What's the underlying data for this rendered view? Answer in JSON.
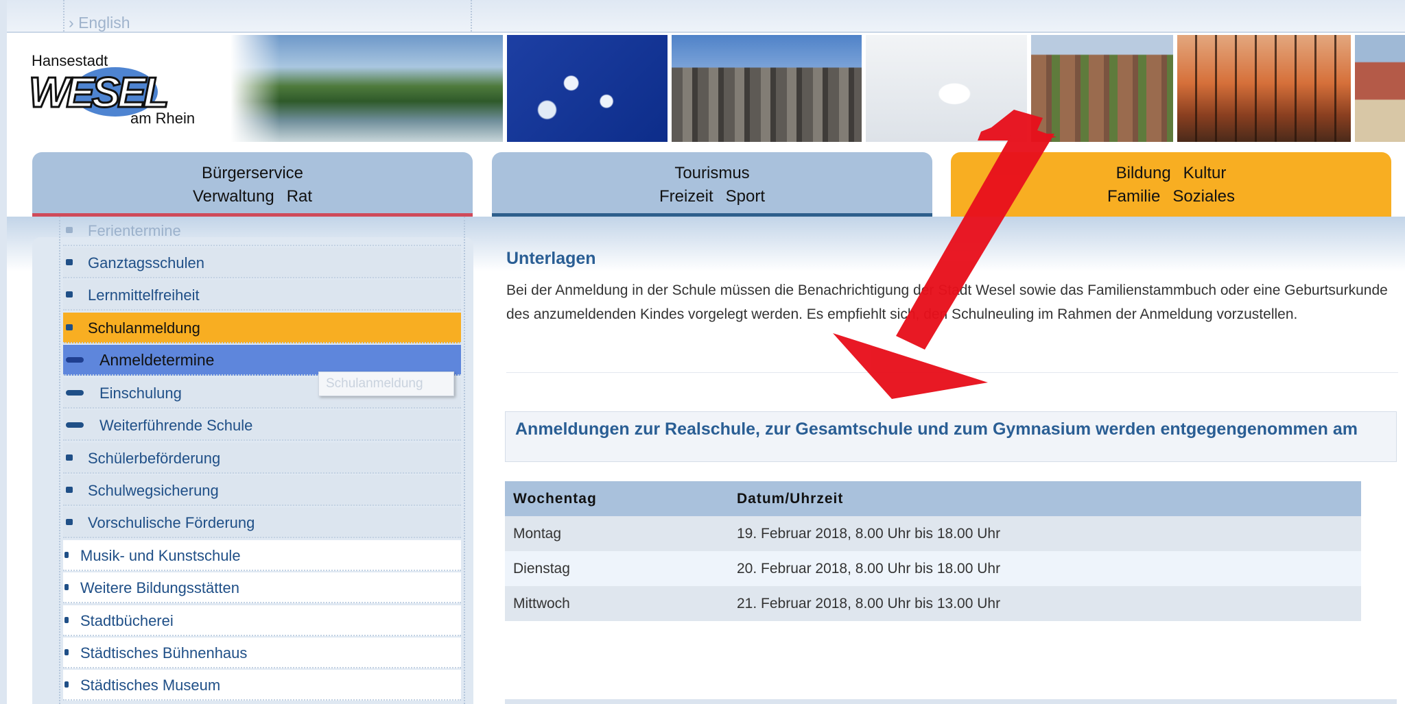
{
  "top_strip": {
    "language_link": "English"
  },
  "logo": {
    "line1": "Hansestadt",
    "wordmark": "WESEL",
    "line2": "am Rhein"
  },
  "nav_tabs": [
    {
      "line1": [
        "Bürgerservice"
      ],
      "line2": [
        "Verwaltung",
        "Rat"
      ]
    },
    {
      "line1": [
        "Tourismus"
      ],
      "line2": [
        "Freizeit",
        "Sport"
      ]
    },
    {
      "line1": [
        "Bildung",
        "Kultur"
      ],
      "line2": [
        "Familie",
        "Soziales"
      ]
    }
  ],
  "sidebar": {
    "items": [
      {
        "label": "Ferientermine"
      },
      {
        "label": "Ganztagsschulen"
      },
      {
        "label": "Lernmittelfreiheit"
      },
      {
        "label": "Schulanmeldung"
      },
      {
        "label": "Anmeldetermine"
      },
      {
        "label": "Einschulung"
      },
      {
        "label": "Weiterführende Schule"
      },
      {
        "label": "Schülerbeförderung"
      },
      {
        "label": "Schulwegsicherung"
      },
      {
        "label": "Vorschulische Förderung"
      },
      {
        "label": "Musik- und Kunstschule"
      },
      {
        "label": "Weitere Bildungsstätten"
      },
      {
        "label": "Stadtbücherei"
      },
      {
        "label": "Städtisches Bühnenhaus"
      },
      {
        "label": "Städtisches Museum"
      }
    ],
    "tooltip_ghost": "Schulanmeldung"
  },
  "main": {
    "section_title": "Unterlagen",
    "section_text": "Bei der Anmeldung in der Schule müssen die Benachrichtigung der Stadt Wesel sowie das Familienstammbuch oder eine Geburtsurkunde des anzumeldenden Kindes vorgelegt werden. Es empfiehlt sich, den Schulneuling im Rahmen der Anmeldung vorzustellen.",
    "info_heading": "Anmeldungen zur Realschule, zur Gesamtschule und zum Gymnasium werden entgegengenommen am",
    "table": {
      "headers": [
        "Wochentag",
        "Datum/Uhrzeit"
      ],
      "rows": [
        [
          "Montag",
          "19. Februar 2018, 8.00 Uhr bis 18.00 Uhr"
        ],
        [
          "Dienstag",
          "20. Februar 2018, 8.00 Uhr bis 18.00 Uhr"
        ],
        [
          "Mittwoch",
          "21. Februar 2018, 8.00 Uhr bis 13.00 Uhr"
        ]
      ]
    }
  },
  "colors": {
    "tab_blue": "#a9c1dc",
    "tab_orange": "#f8ae22",
    "link_blue": "#1f4f87",
    "heading_blue": "#2a5e94",
    "active_item": "#f8ae22",
    "current_item": "#5e86dc",
    "annotation_arrow": "#e8101c"
  }
}
